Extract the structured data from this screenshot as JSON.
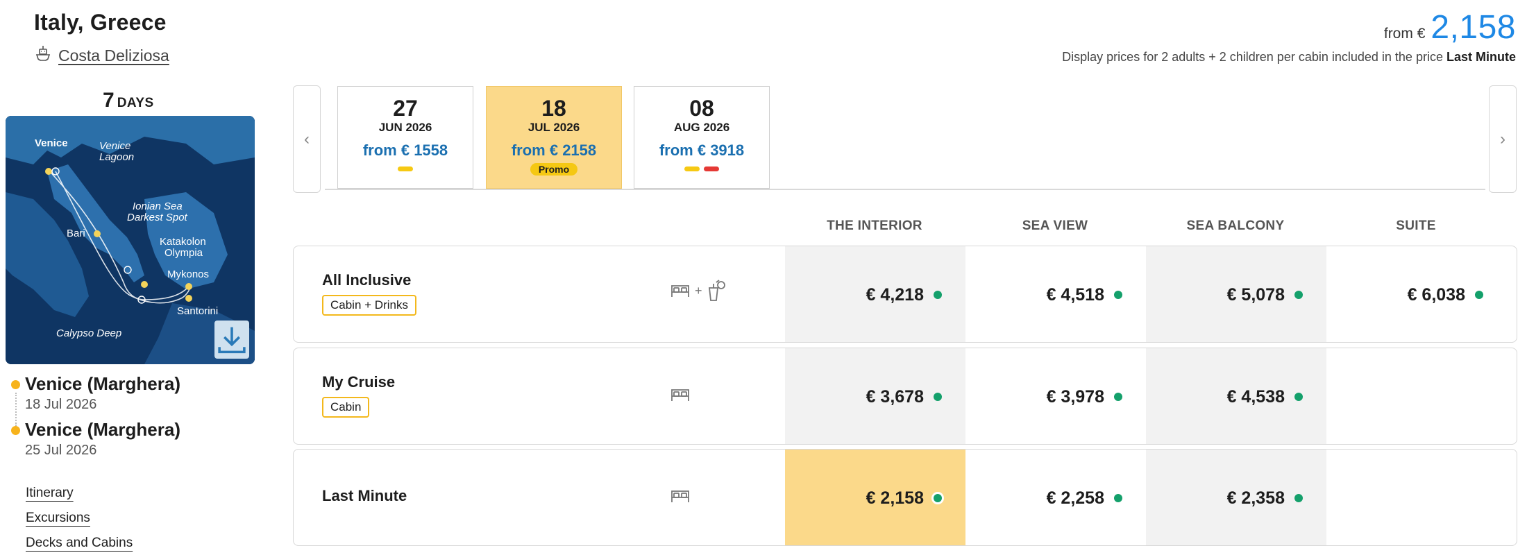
{
  "header": {
    "title": "Italy, Greece",
    "ship_name": "Costa Deliziosa",
    "price_from_label": "from €",
    "price_from_amount": "2,158",
    "price_note_prefix": "Display prices for 2 adults + 2 children per cabin included in the price",
    "price_note_highlight": "Last Minute"
  },
  "trip": {
    "days_number": "7",
    "days_unit": "DAYS",
    "map_labels": [
      "Venice",
      "Venice",
      "Lagoon",
      "Ionian Sea",
      "Darkest Spot",
      "Bari",
      "Katakolon",
      "Olympia",
      "Mykonos",
      "Santorini",
      "Calypso Deep"
    ],
    "departure": {
      "port": "Venice (Marghera)",
      "date": "18 Jul 2026"
    },
    "arrival": {
      "port": "Venice (Marghera)",
      "date": "25 Jul 2026"
    },
    "links": [
      "Itinerary",
      "Excursions",
      "Decks and Cabins"
    ]
  },
  "dates": [
    {
      "day": "27",
      "month": "JUN 2026",
      "from": "from € 1558",
      "marks": [
        "yellow"
      ],
      "promo": ""
    },
    {
      "day": "18",
      "month": "JUL 2026",
      "from": "from € 2158",
      "marks": [],
      "promo": "Promo",
      "selected": true
    },
    {
      "day": "08",
      "month": "AUG 2026",
      "from": "from € 3918",
      "marks": [
        "yellow",
        "red"
      ],
      "promo": ""
    }
  ],
  "columns": [
    "THE INTERIOR",
    "SEA VIEW",
    "SEA BALCONY",
    "SUITE"
  ],
  "rows": [
    {
      "label": "All Inclusive",
      "tag": "Cabin + Drinks",
      "icons": [
        "bed-icon",
        "drinks-icon"
      ],
      "plus": "+",
      "prices": [
        "€ 4,218",
        "€ 4,518",
        "€ 5,078",
        "€ 6,038"
      ]
    },
    {
      "label": "My Cruise",
      "tag": "Cabin",
      "icons": [
        "bed-icon"
      ],
      "prices": [
        "€ 3,678",
        "€ 3,978",
        "€ 4,538",
        ""
      ]
    },
    {
      "label": "Last Minute",
      "tag": "",
      "icons": [
        "bed-icon"
      ],
      "prices": [
        "€ 2,158",
        "€ 2,258",
        "€ 2,358",
        ""
      ]
    }
  ],
  "colors": {
    "accent_blue": "#1e88e5",
    "highlight_yellow": "#fbd98a",
    "available_green": "#14a06b",
    "tag_border": "#f3b81c"
  }
}
